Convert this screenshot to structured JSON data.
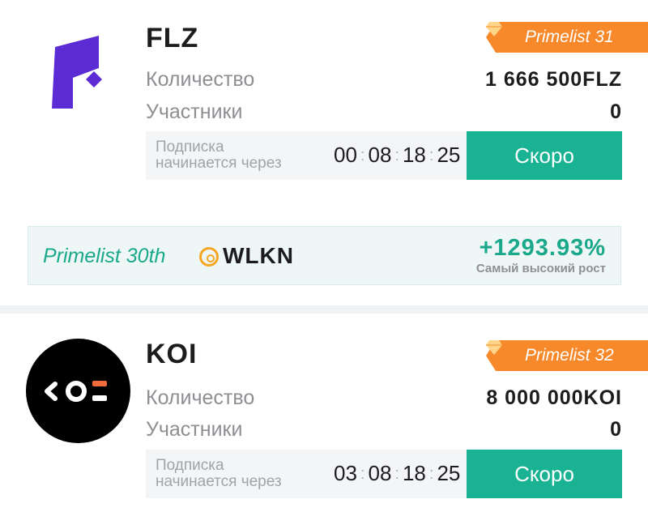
{
  "listings": [
    {
      "token": "FLZ",
      "badge": "Primelist 31",
      "quantity_label": "Количество",
      "quantity_value": "1 666 500FLZ",
      "participants_label": "Участники",
      "participants_value": "0",
      "subscription_label_line1": "Подписка",
      "subscription_label_line2": "начинается через",
      "timer": [
        "00",
        "08",
        "18",
        "25"
      ],
      "button": "Скоро",
      "logo_icon": "flz-logo-icon"
    },
    {
      "token": "KOI",
      "badge": "Primelist 32",
      "quantity_label": "Количество",
      "quantity_value": "8 000 000KOI",
      "participants_label": "Участники",
      "participants_value": "0",
      "subscription_label_line1": "Подписка",
      "subscription_label_line2": "начинается через",
      "timer": [
        "03",
        "08",
        "18",
        "25"
      ],
      "button": "Скоро",
      "logo_icon": "koi-logo-icon"
    }
  ],
  "promo": {
    "title": "Primelist 30th",
    "token": "WLKN",
    "growth": "+1293.93%",
    "growth_label": "Самый высокий рост",
    "coin_icon": "wlkn-coin-icon"
  },
  "colors": {
    "accent_green": "#19b393",
    "badge_orange": "#f7892a",
    "flz_purple": "#5b2bd4",
    "koi_orange": "#f26b3a"
  }
}
